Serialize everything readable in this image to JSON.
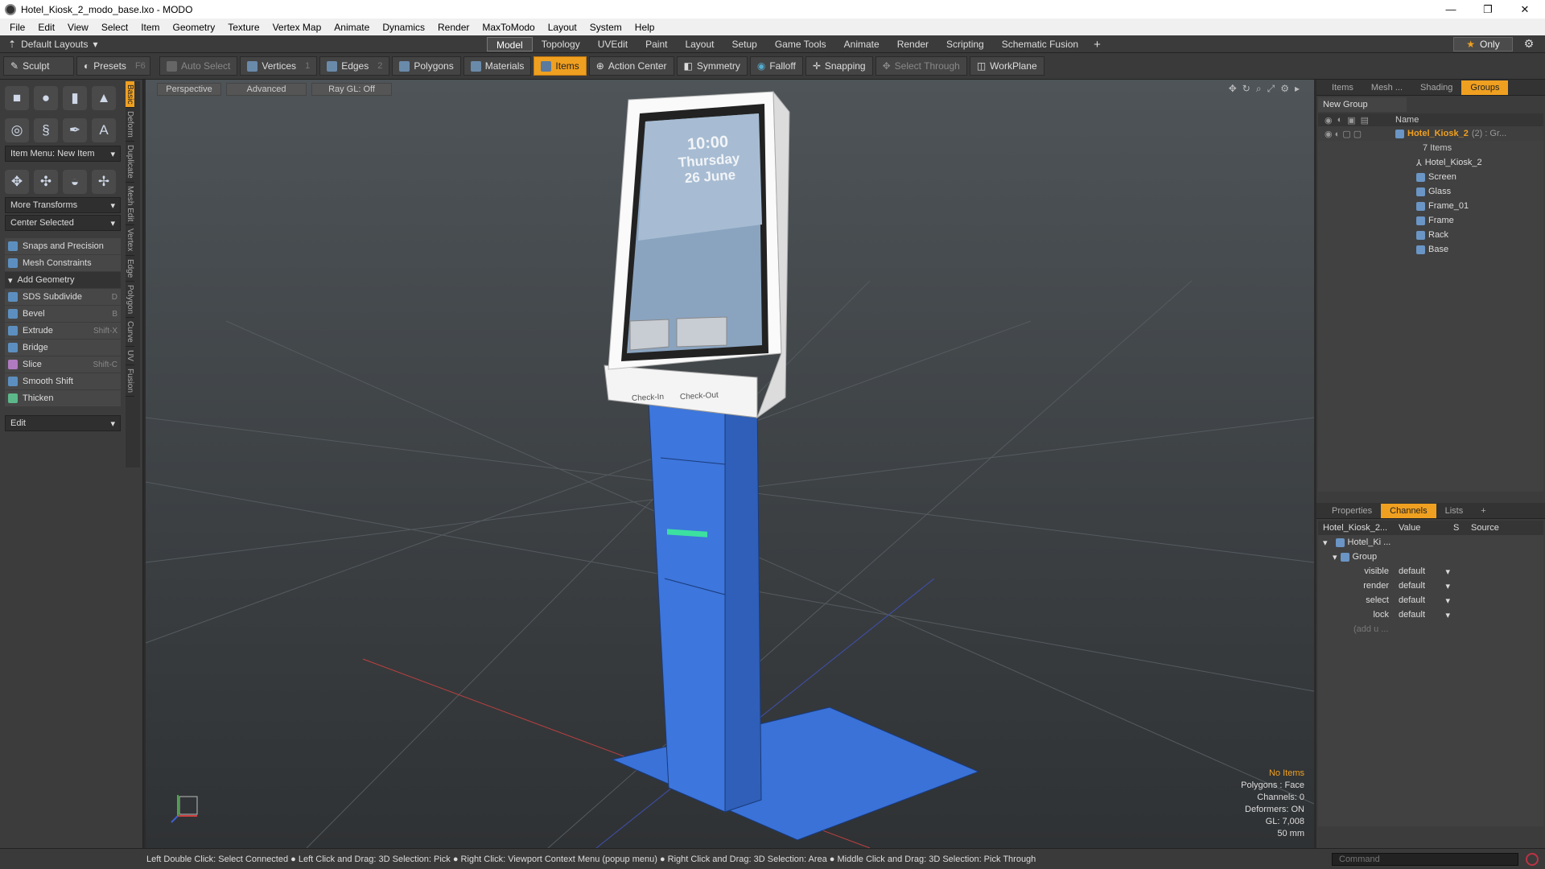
{
  "window": {
    "title": "Hotel_Kiosk_2_modo_base.lxo - MODO",
    "minimize": "—",
    "maximize": "❐",
    "close": "✕"
  },
  "menu": [
    "File",
    "Edit",
    "View",
    "Select",
    "Item",
    "Geometry",
    "Texture",
    "Vertex Map",
    "Animate",
    "Dynamics",
    "Render",
    "MaxToModo",
    "Layout",
    "System",
    "Help"
  ],
  "layoutbar": {
    "default_layouts": "Default Layouts",
    "tabs": [
      "Model",
      "Topology",
      "UVEdit",
      "Paint",
      "Layout",
      "Setup",
      "Game Tools",
      "Animate",
      "Render",
      "Scripting",
      "Schematic Fusion"
    ],
    "active_tab": "Model",
    "only_label": "Only"
  },
  "toolbar": {
    "sculpt": "Sculpt",
    "presets": "Presets",
    "presets_key": "F6",
    "auto_select": "Auto Select",
    "vertices": "Vertices",
    "vertices_num": "1",
    "edges": "Edges",
    "edges_num": "2",
    "polygons": "Polygons",
    "materials": "Materials",
    "items": "Items",
    "action_center": "Action Center",
    "symmetry": "Symmetry",
    "falloff": "Falloff",
    "snapping": "Snapping",
    "select_through": "Select Through",
    "workplane": "WorkPlane"
  },
  "leftpanel": {
    "item_menu": "Item Menu: New Item",
    "more_transforms": "More Transforms",
    "center_selected": "Center Selected",
    "snaps": "Snaps and Precision",
    "mesh_constraints": "Mesh Constraints",
    "add_geometry": "Add Geometry",
    "tools": [
      {
        "label": "SDS Subdivide",
        "key": "D"
      },
      {
        "label": "Bevel",
        "key": "B"
      },
      {
        "label": "Extrude",
        "key": "Shift-X"
      },
      {
        "label": "Bridge",
        "key": ""
      },
      {
        "label": "Slice",
        "key": "Shift-C"
      },
      {
        "label": "Smooth Shift",
        "key": ""
      },
      {
        "label": "Thicken",
        "key": ""
      }
    ],
    "edit": "Edit",
    "vtabs": [
      "Basic",
      "Deform",
      "Duplicate",
      "Mesh Edit",
      "Vertex",
      "Edge",
      "Polygon",
      "Curve",
      "UV",
      "Fusion"
    ]
  },
  "viewport": {
    "perspective": "Perspective",
    "advanced": "Advanced",
    "raygl": "Ray GL: Off",
    "screen_time": "10:00",
    "screen_day": "Thursday",
    "screen_date": "26 June",
    "checkin": "Check-In",
    "checkout": "Check-Out",
    "info": {
      "no_items": "No Items",
      "polygons": "Polygons : Face",
      "channels": "Channels: 0",
      "deformers": "Deformers: ON",
      "gl": "GL: 7,008",
      "unit": "50 mm"
    }
  },
  "groups_panel": {
    "tabs": [
      "Items",
      "Mesh ...",
      "Shading",
      "Groups"
    ],
    "active": "Groups",
    "new_group": "New Group",
    "name_header": "Name",
    "root": "Hotel_Kiosk_2",
    "root_suffix": "(2) : Gr...",
    "count": "7 Items",
    "children": [
      "Hotel_Kiosk_2",
      "Screen",
      "Glass",
      "Frame_01",
      "Frame",
      "Rack",
      "Base"
    ]
  },
  "channels_panel": {
    "tabs": [
      "Properties",
      "Channels",
      "Lists",
      "+"
    ],
    "active": "Channels",
    "header_name": "Hotel_Kiosk_2...",
    "header_value": "Value",
    "header_s": "S",
    "header_source": "Source",
    "item": "Hotel_Ki ...",
    "group": "Group",
    "rows": [
      {
        "name": "visible",
        "value": "default"
      },
      {
        "name": "render",
        "value": "default"
      },
      {
        "name": "select",
        "value": "default"
      },
      {
        "name": "lock",
        "value": "default"
      }
    ],
    "add": "(add u ..."
  },
  "statusbar": {
    "hint": "Left Double Click: Select Connected ● Left Click and Drag: 3D Selection: Pick ● Right Click: Viewport Context Menu (popup menu) ● Right Click and Drag: 3D Selection: Area ● Middle Click and Drag: 3D Selection: Pick Through",
    "command_placeholder": "Command"
  }
}
